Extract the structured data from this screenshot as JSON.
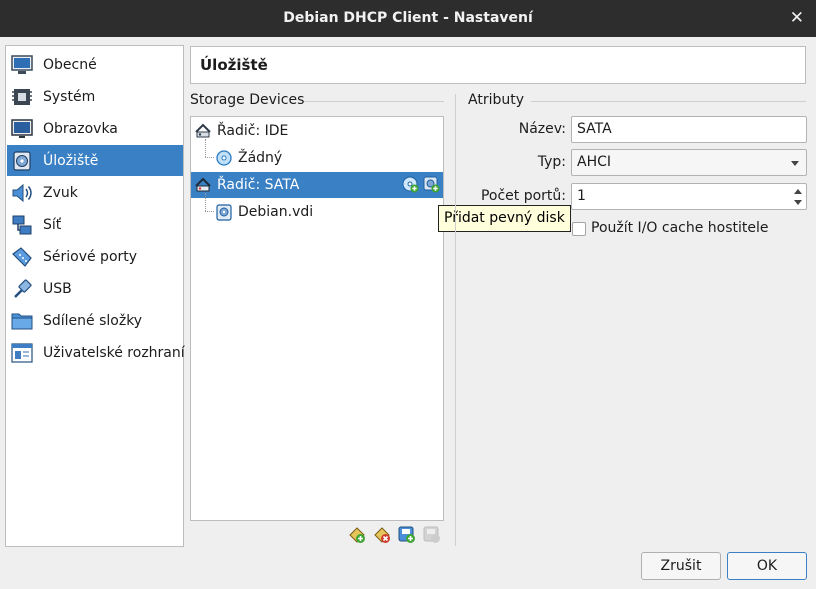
{
  "window": {
    "title": "Debian DHCP Client - Nastavení",
    "close_glyph": "✕"
  },
  "sidebar": {
    "items": [
      {
        "label": "Obecné",
        "icon": "monitor-icon"
      },
      {
        "label": "Systém",
        "icon": "chip-icon"
      },
      {
        "label": "Obrazovka",
        "icon": "display-icon"
      },
      {
        "label": "Úložiště",
        "icon": "storage-icon",
        "active": true
      },
      {
        "label": "Zvuk",
        "icon": "speaker-icon"
      },
      {
        "label": "Síť",
        "icon": "network-icon"
      },
      {
        "label": "Sériové porty",
        "icon": "serial-port-icon"
      },
      {
        "label": "USB",
        "icon": "usb-icon"
      },
      {
        "label": "Sdílené složky",
        "icon": "shared-folder-icon"
      },
      {
        "label": "Uživatelské rozhraní",
        "icon": "user-interface-icon"
      }
    ]
  },
  "page": {
    "title": "Úložiště"
  },
  "storage": {
    "group_title": "Storage Devices",
    "tree": [
      {
        "label": "Řadič: IDE",
        "kind": "controller"
      },
      {
        "label": "Žádný",
        "kind": "optical-drive"
      },
      {
        "label": "Řadič: SATA",
        "kind": "controller",
        "selected": true
      },
      {
        "label": "Debian.vdi",
        "kind": "hard-disk"
      }
    ],
    "tooltip": "Přidat pevný disk"
  },
  "attributes": {
    "group_title": "Atributy",
    "name_label": "Název:",
    "name_value": "SATA",
    "type_label": "Typ:",
    "type_value": "AHCI",
    "ports_label": "Počet portů:",
    "ports_value": "1",
    "cache_label": "Použít I/O cache hostitele",
    "cache_checked": false
  },
  "buttons": {
    "cancel": "Zrušit",
    "ok": "OK"
  }
}
